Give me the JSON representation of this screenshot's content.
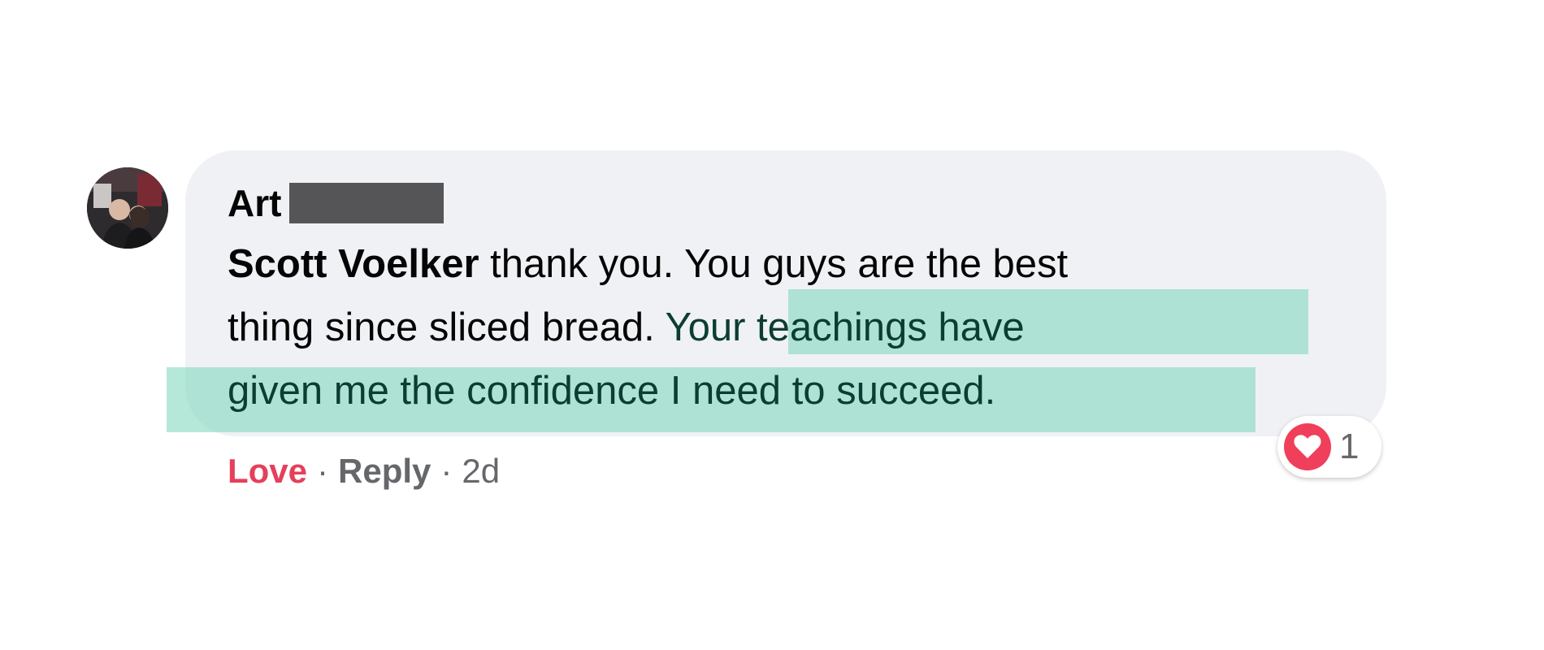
{
  "comment": {
    "author_name": "Art",
    "mention": "Scott Voelker",
    "line1_rest": " thank you. You guys are the best",
    "line2_plain": "thing since sliced bread. ",
    "line2_highlight": "Your teachings have",
    "line3_highlight": "given me the confidence I need to succeed.",
    "actions": {
      "love_label": "Love",
      "separator": "·",
      "reply_label": "Reply",
      "age": "2d"
    },
    "reaction": {
      "icon": "heart-icon",
      "count": "1"
    }
  },
  "colors": {
    "bubble": "#f0f1f5",
    "love": "#e4405a",
    "muted": "#65676b",
    "highlight": "#78d6ba",
    "redaction": "#555456",
    "heart_badge": "#ef3f5b"
  }
}
